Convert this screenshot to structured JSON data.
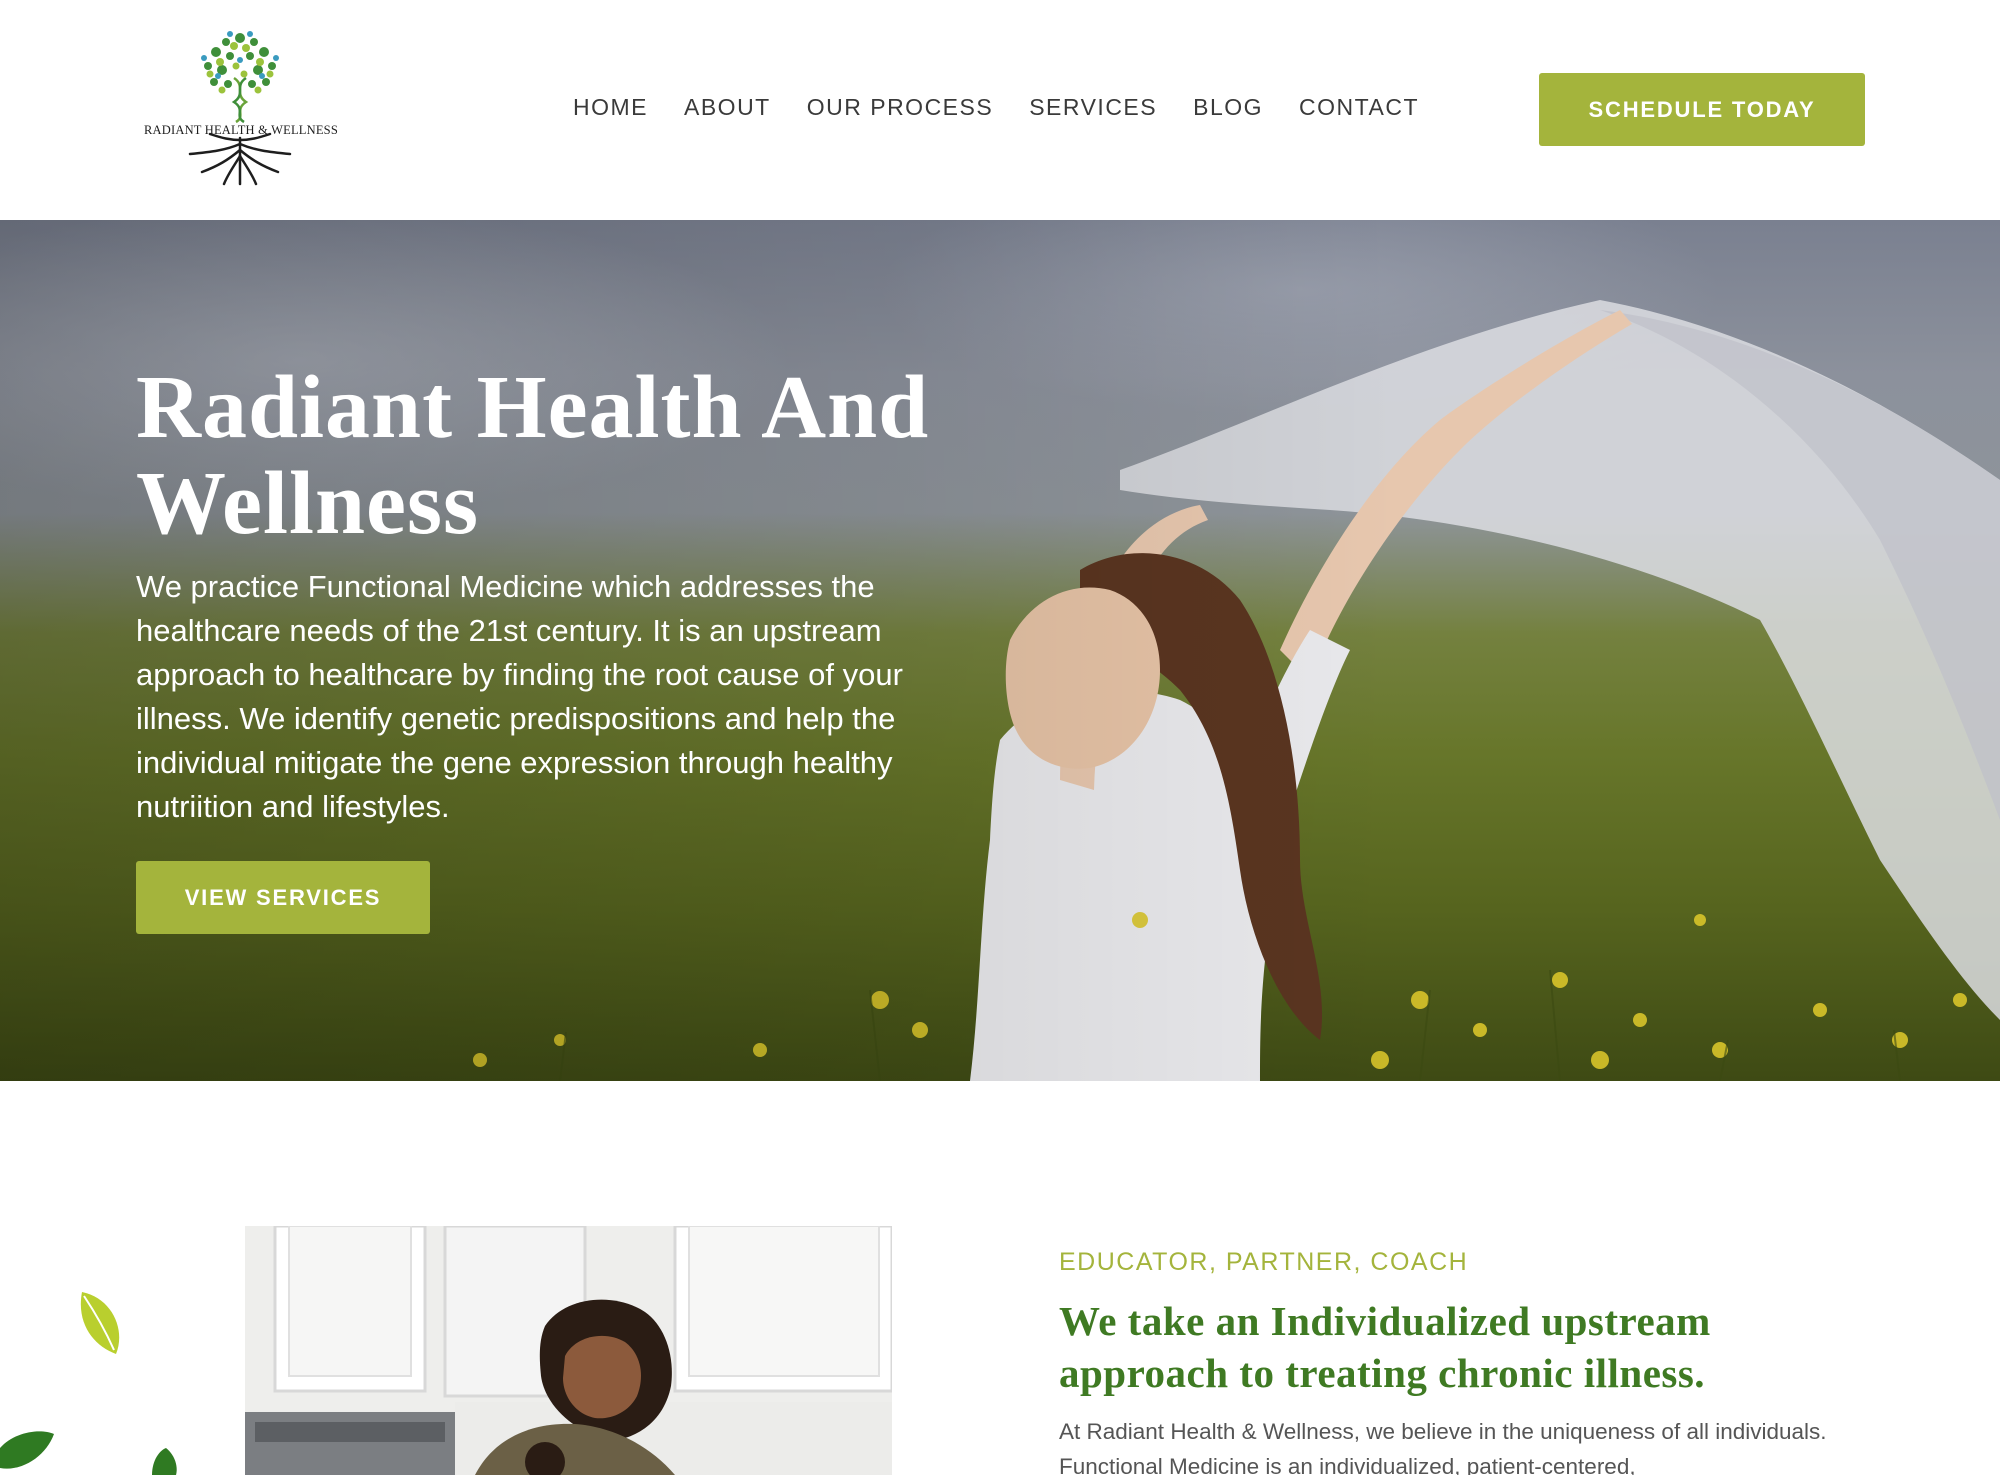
{
  "header": {
    "logo_text": "RADIANT HEALTH & WELLNESS",
    "nav": [
      "HOME",
      "ABOUT",
      "OUR PROCESS",
      "SERVICES",
      "BLOG",
      "CONTACT"
    ],
    "cta_label": "SCHEDULE TODAY"
  },
  "hero": {
    "title": "Radiant Health And Wellness",
    "description": "We practice Functional Medicine which addresses the healthcare needs of the 21st century. It is an upstream approach to healthcare by finding the root cause of your illness.  We identify genetic predispositions and help the individual mitigate the gene expression through healthy nutriition and lifestyles.",
    "button_label": "VIEW SERVICES"
  },
  "about": {
    "eyebrow": "EDUCATOR, PARTNER, COACH",
    "title": "We take an Individualized upstream approach to treating chronic illness.",
    "text": "At Radiant Health & Wellness, we believe in the uniqueness of all individuals.  Functional Medicine is an individualized, patient-centered,"
  },
  "colors": {
    "accent": "#a4b43c",
    "heading_green": "#3f7a23",
    "nav_text": "#3a3a3a",
    "body_text": "#555555"
  },
  "icons": [
    "tree-logo-icon",
    "leaf-icon"
  ]
}
